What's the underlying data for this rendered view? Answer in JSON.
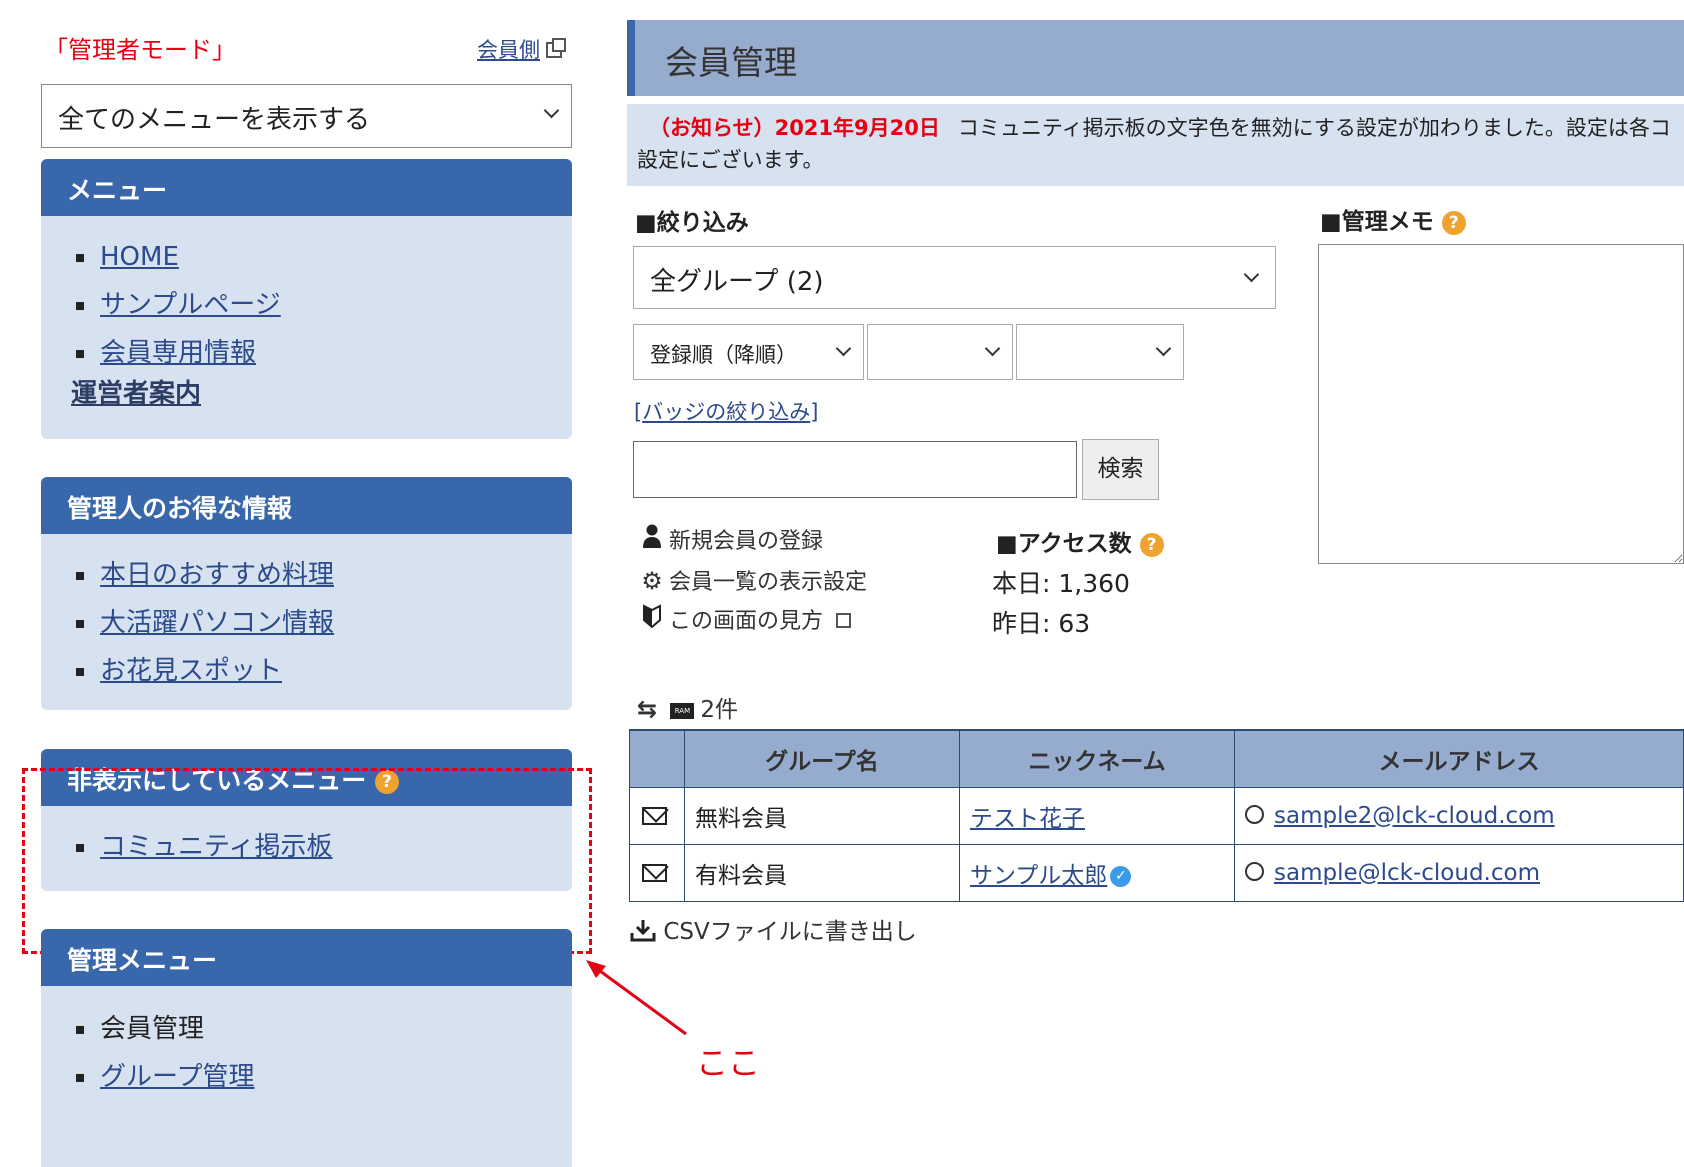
{
  "sidebar": {
    "mode_label": "「管理者モード」",
    "member_side_link": "会員側",
    "menu_select_value": "全てのメニューを表示する",
    "panels": {
      "menu": {
        "title": "メニュー",
        "items": [
          "HOME",
          "サンプルページ",
          "会員専用情報"
        ],
        "bold_link": "運営者案内"
      },
      "info": {
        "title": "管理人のお得な情報",
        "items": [
          "本日のおすすめ料理",
          "大活躍パソコン情報",
          "お花見スポット"
        ]
      },
      "hidden": {
        "title": "非表示にしているメニュー",
        "items": [
          "コミュニティ掲示板"
        ]
      },
      "admin": {
        "title": "管理メニュー",
        "items": [
          "会員管理",
          "グループ管理"
        ]
      }
    }
  },
  "annotation": {
    "text": "ここ",
    "color": "#e60012"
  },
  "header": {
    "title": "会員管理"
  },
  "notice": {
    "date_label": "（お知らせ）2021年9月20日",
    "text": "コミュニティ掲示板の文字色を無効にする設定が加わりました。設定は各コ",
    "text_line2": "設定にございます。"
  },
  "filter": {
    "title": "■絞り込み",
    "group_select": "全グループ (2)",
    "sort_select": "登録順（降順）",
    "badge_filter": "バッジの絞り込み",
    "search_button": "検索",
    "search_placeholder": ""
  },
  "actions": {
    "new_member": "新規会員の登録",
    "list_settings": "会員一覧の表示設定",
    "how_to_view": "この画面の見方"
  },
  "access": {
    "title": "■アクセス数",
    "today": "本日: 1,360",
    "yesterday": "昨日: 63"
  },
  "memo": {
    "title": "■管理メモ"
  },
  "list": {
    "count": "2件",
    "columns": [
      "グループ名",
      "ニックネーム",
      "メールアドレス"
    ],
    "rows": [
      {
        "group": "無料会員",
        "nickname": "テスト花子",
        "email": "sample2@lck-cloud.com",
        "verified": false
      },
      {
        "group": "有料会員",
        "nickname": "サンプル太郎",
        "email": "sample@lck-cloud.com",
        "verified": true
      }
    ],
    "csv_export": "CSVファイルに書き出し"
  },
  "colors": {
    "accent_blue": "#3868ab",
    "panel_bg": "#d7e2f0",
    "header_bg": "#96acce",
    "warning_red": "#e60012",
    "help_orange": "#f0a22e"
  },
  "icons": [
    "external-link-icon",
    "chevron-down-icon",
    "help-icon",
    "user-icon",
    "gear-icon",
    "beginner-mark-icon",
    "swap-icon",
    "ram-icon",
    "mail-icon",
    "circle-icon",
    "verified-icon",
    "download-icon"
  ]
}
